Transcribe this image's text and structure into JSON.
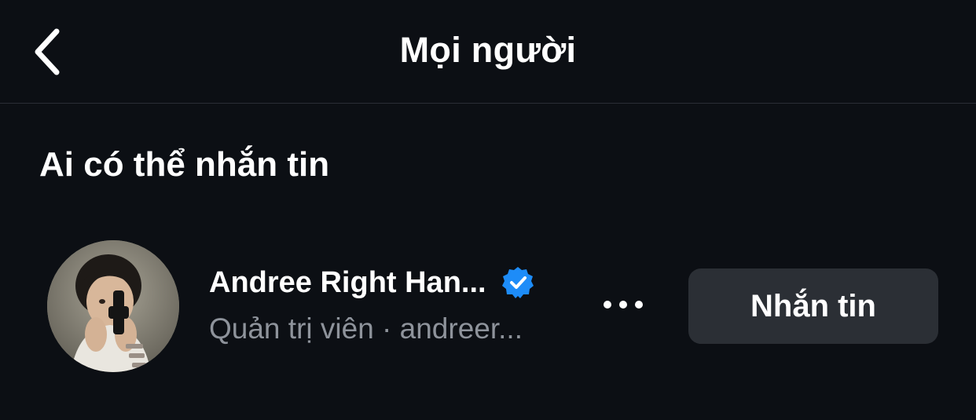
{
  "header": {
    "title": "Mọi người",
    "back_icon": "chevron-left-icon"
  },
  "section": {
    "title": "Ai có thể nhắn tin"
  },
  "member": {
    "name": "Andree Right Han...",
    "verified_icon": "verified-badge-icon",
    "subtitle": "Quản trị viên · andreer...",
    "more_icon": "more-horizontal-icon",
    "message_button_label": "Nhắn tin"
  },
  "colors": {
    "background": "#0c0f14",
    "divider": "#2a2e35",
    "text_primary": "#ffffff",
    "text_secondary": "#8e939b",
    "button_bg": "#2b2f35",
    "verified_blue": "#1d8cf8"
  }
}
